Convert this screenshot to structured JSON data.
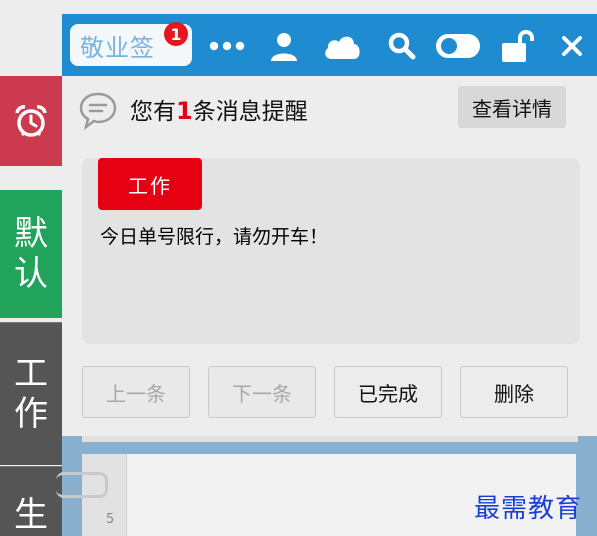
{
  "header": {
    "logo_text": "敬业签",
    "badge_count": "1",
    "icons": [
      "more-icon",
      "user-icon",
      "cloud-icon",
      "search-icon",
      "toggle-icon",
      "unlock-icon",
      "close-icon"
    ],
    "color": "#1f8bd0"
  },
  "sidebar": {
    "items": [
      {
        "icon": "alarm-clock-icon",
        "color": "#cc3a4f"
      },
      {
        "label_1": "默",
        "label_2": "认",
        "color": "#22a35c"
      },
      {
        "label_1": "工",
        "label_2": "作",
        "color": "#555555"
      },
      {
        "label_1": "生",
        "color": "#555555"
      }
    ]
  },
  "message": {
    "prefix": "您有",
    "count": "1",
    "suffix": "条消息提醒",
    "detail_button": "查看详情"
  },
  "reminder": {
    "tag": "工作",
    "tag_color": "#e50012",
    "content": "今日单号限行，请勿开车！"
  },
  "actions": {
    "prev": "上一条",
    "next": "下一条",
    "done": "已完成",
    "delete": "删除"
  },
  "note": {
    "line_number": "5"
  },
  "watermark": "最需教育"
}
